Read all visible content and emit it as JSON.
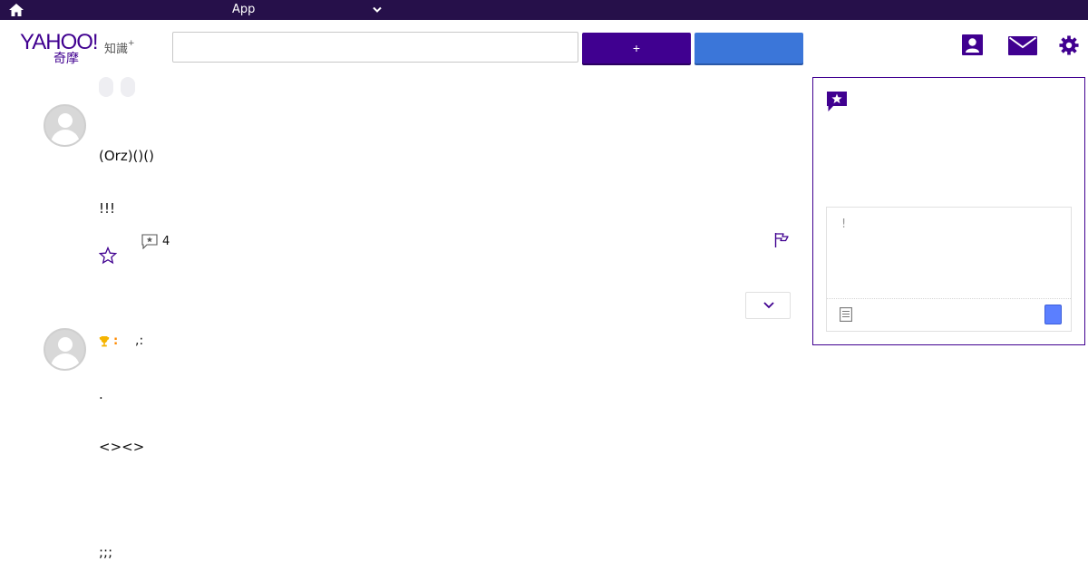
{
  "topbar": {
    "app_label": "App"
  },
  "header": {
    "logo_text": "YAHOO!",
    "logo_sub": "知識",
    "logo_plus": "+",
    "logo_cn": "奇摩",
    "search_value": "",
    "ask_button_label": "+",
    "blue_button_label": ""
  },
  "question": {
    "title": "",
    "lines": [
      "(Orz)()()",
      "!!!"
    ],
    "comment_count": "4"
  },
  "answers": {
    "heading": "",
    "best_marker": ":",
    "best_meta": ",:",
    "lines": [
      ".",
      "<><>",
      ";;;"
    ]
  },
  "panel": {
    "input_placeholder": "!"
  },
  "colors": {
    "brand_purple": "#400090",
    "topbar_bg": "#26104a",
    "accent_blue": "#3b76d9",
    "submit_blue": "#5b7fff",
    "trophy_gold": "#f5b400"
  },
  "icons": [
    "home-icon",
    "chevron-down-icon",
    "profile-icon",
    "mail-icon",
    "gear-icon",
    "star-icon",
    "comment-icon",
    "flag-icon",
    "trophy-icon",
    "panel-star-icon",
    "document-icon"
  ]
}
